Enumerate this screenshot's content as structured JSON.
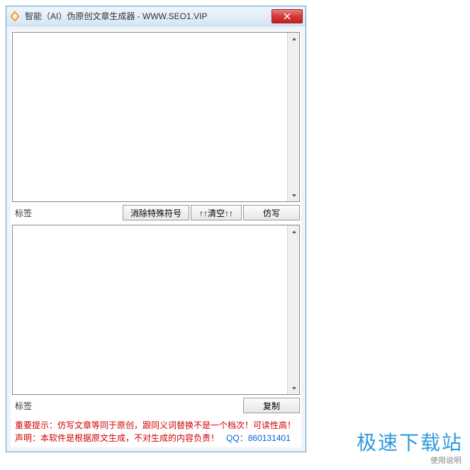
{
  "window": {
    "title": "智能（AI）伪原创文章生成器 - WWW.SEO1.VIP"
  },
  "topSection": {
    "label": "标签",
    "buttons": {
      "removeSpecial": "消除特殊符号",
      "clear": "↑↑清空↑↑",
      "rewrite": "仿写"
    }
  },
  "bottomSection": {
    "label": "标签",
    "buttons": {
      "copy": "复制"
    }
  },
  "footer": {
    "line1_prefix": "重要提示：",
    "line1_text": "仿写文章等同于原创，跟同义词替换不是一个档次！可读性高！",
    "line2_prefix": "声明：",
    "line2_text": "本软件是根据原文生成，不对生成的内容负责！",
    "qq_label": "QQ：",
    "qq_number": "860131401"
  },
  "watermark": {
    "main": "极速下载站",
    "small": "使用说明"
  }
}
